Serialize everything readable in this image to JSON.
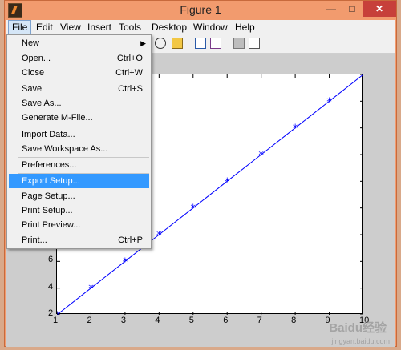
{
  "window": {
    "title": "Figure 1"
  },
  "titlebar_buttons": [
    "—",
    "□",
    "✕"
  ],
  "menubar": [
    "File",
    "Edit",
    "View",
    "Insert",
    "Tools",
    "Desktop",
    "Window",
    "Help"
  ],
  "file_menu": [
    {
      "label": "New",
      "shortcut": "",
      "submenu": true
    },
    {
      "label": "Open...",
      "shortcut": "Ctrl+O"
    },
    {
      "label": "Close",
      "shortcut": "Ctrl+W"
    },
    {
      "label": "Save",
      "shortcut": "Ctrl+S"
    },
    {
      "label": "Save As...",
      "shortcut": ""
    },
    {
      "label": "Generate M-File...",
      "shortcut": ""
    },
    {
      "label": "Import Data...",
      "shortcut": ""
    },
    {
      "label": "Save Workspace As...",
      "shortcut": ""
    },
    {
      "label": "Preferences...",
      "shortcut": ""
    },
    {
      "label": "Export Setup...",
      "shortcut": "",
      "highlighted": true
    },
    {
      "label": "Page Setup...",
      "shortcut": ""
    },
    {
      "label": "Print Setup...",
      "shortcut": ""
    },
    {
      "label": "Print Preview...",
      "shortcut": ""
    },
    {
      "label": "Print...",
      "shortcut": "Ctrl+P"
    }
  ],
  "chart_data": {
    "type": "line",
    "x": [
      1,
      2,
      3,
      4,
      5,
      6,
      7,
      8,
      9,
      10
    ],
    "series": [
      {
        "values": [
          2,
          4,
          6,
          8,
          10,
          12,
          14,
          16,
          18,
          20
        ],
        "marker": "*",
        "color": "#0000ff"
      }
    ],
    "xticks": [
      "1",
      "2",
      "3",
      "4",
      "5",
      "6",
      "7",
      "8",
      "9",
      "10"
    ],
    "yticks_visible": [
      "2",
      "4",
      "6"
    ],
    "xlim": [
      1,
      10
    ],
    "ylim": [
      2,
      20
    ]
  },
  "watermark": {
    "text": "Baidu经验",
    "sub": "jingyan.baidu.com"
  }
}
